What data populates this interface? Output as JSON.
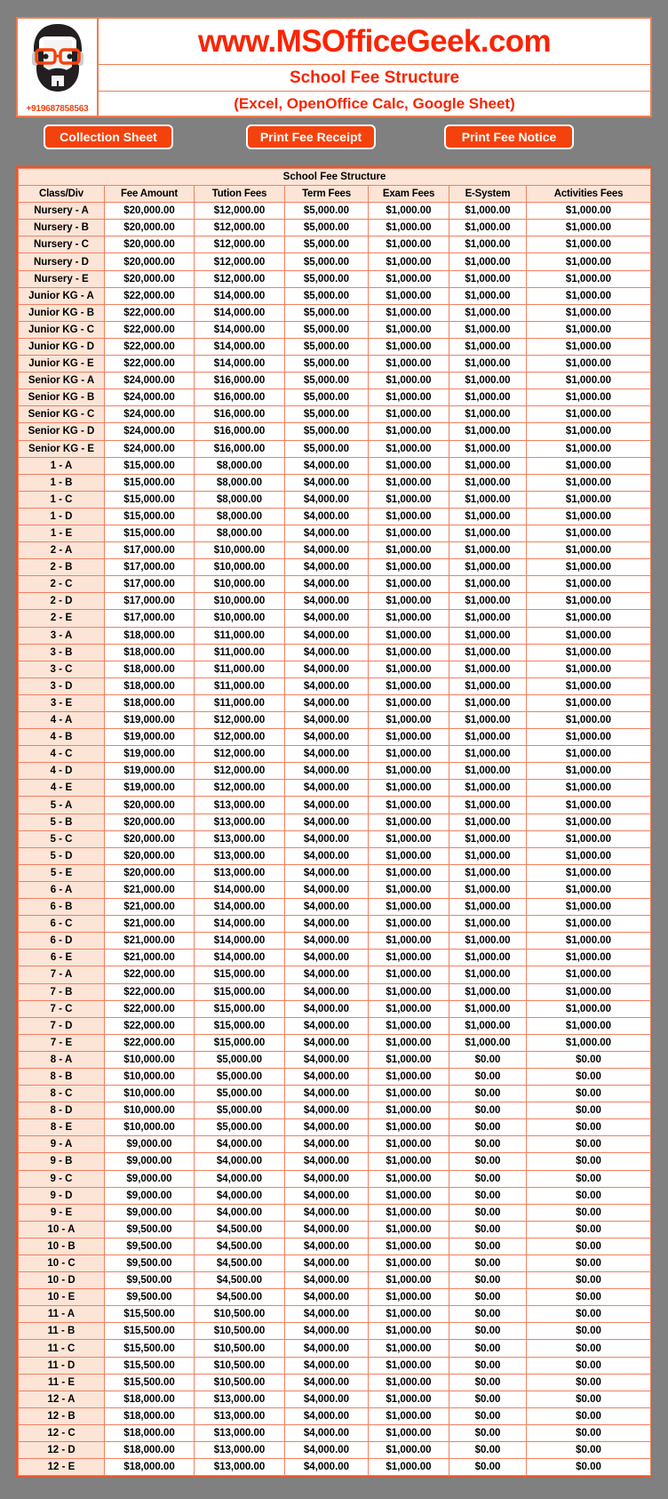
{
  "banner": {
    "site_title": "www.MSOfficeGeek.com",
    "sub_title": "School Fee Structure",
    "sub_title2": "(Excel, OpenOffice Calc, Google Sheet)",
    "logo_phone": "+919687858563",
    "accent_red": "#FA2400",
    "accent_orange": "#F4420D",
    "border_orange": "#ED7D52",
    "row_peach": "#FCE4D6",
    "page_bg": "#808080"
  },
  "toolbar": {
    "collection_label": "Collection Sheet",
    "receipt_label": "Print Fee Receipt",
    "notice_label": "Print Fee Notice"
  },
  "table": {
    "title": "School Fee Structure",
    "columns": [
      "Class/Div",
      "Fee Amount",
      "Tution Fees",
      "Term Fees",
      "Exam Fees",
      "E-System",
      "Activities Fees"
    ],
    "rows": [
      [
        "Nursery - A",
        "$20,000.00",
        "$12,000.00",
        "$5,000.00",
        "$1,000.00",
        "$1,000.00",
        "$1,000.00"
      ],
      [
        "Nursery - B",
        "$20,000.00",
        "$12,000.00",
        "$5,000.00",
        "$1,000.00",
        "$1,000.00",
        "$1,000.00"
      ],
      [
        "Nursery - C",
        "$20,000.00",
        "$12,000.00",
        "$5,000.00",
        "$1,000.00",
        "$1,000.00",
        "$1,000.00"
      ],
      [
        "Nursery - D",
        "$20,000.00",
        "$12,000.00",
        "$5,000.00",
        "$1,000.00",
        "$1,000.00",
        "$1,000.00"
      ],
      [
        "Nursery - E",
        "$20,000.00",
        "$12,000.00",
        "$5,000.00",
        "$1,000.00",
        "$1,000.00",
        "$1,000.00"
      ],
      [
        "Junior KG - A",
        "$22,000.00",
        "$14,000.00",
        "$5,000.00",
        "$1,000.00",
        "$1,000.00",
        "$1,000.00"
      ],
      [
        "Junior KG - B",
        "$22,000.00",
        "$14,000.00",
        "$5,000.00",
        "$1,000.00",
        "$1,000.00",
        "$1,000.00"
      ],
      [
        "Junior KG - C",
        "$22,000.00",
        "$14,000.00",
        "$5,000.00",
        "$1,000.00",
        "$1,000.00",
        "$1,000.00"
      ],
      [
        "Junior KG - D",
        "$22,000.00",
        "$14,000.00",
        "$5,000.00",
        "$1,000.00",
        "$1,000.00",
        "$1,000.00"
      ],
      [
        "Junior KG - E",
        "$22,000.00",
        "$14,000.00",
        "$5,000.00",
        "$1,000.00",
        "$1,000.00",
        "$1,000.00"
      ],
      [
        "Senior KG - A",
        "$24,000.00",
        "$16,000.00",
        "$5,000.00",
        "$1,000.00",
        "$1,000.00",
        "$1,000.00"
      ],
      [
        "Senior KG - B",
        "$24,000.00",
        "$16,000.00",
        "$5,000.00",
        "$1,000.00",
        "$1,000.00",
        "$1,000.00"
      ],
      [
        "Senior KG - C",
        "$24,000.00",
        "$16,000.00",
        "$5,000.00",
        "$1,000.00",
        "$1,000.00",
        "$1,000.00"
      ],
      [
        "Senior KG - D",
        "$24,000.00",
        "$16,000.00",
        "$5,000.00",
        "$1,000.00",
        "$1,000.00",
        "$1,000.00"
      ],
      [
        "Senior KG - E",
        "$24,000.00",
        "$16,000.00",
        "$5,000.00",
        "$1,000.00",
        "$1,000.00",
        "$1,000.00"
      ],
      [
        "1 - A",
        "$15,000.00",
        "$8,000.00",
        "$4,000.00",
        "$1,000.00",
        "$1,000.00",
        "$1,000.00"
      ],
      [
        "1 - B",
        "$15,000.00",
        "$8,000.00",
        "$4,000.00",
        "$1,000.00",
        "$1,000.00",
        "$1,000.00"
      ],
      [
        "1 - C",
        "$15,000.00",
        "$8,000.00",
        "$4,000.00",
        "$1,000.00",
        "$1,000.00",
        "$1,000.00"
      ],
      [
        "1 - D",
        "$15,000.00",
        "$8,000.00",
        "$4,000.00",
        "$1,000.00",
        "$1,000.00",
        "$1,000.00"
      ],
      [
        "1 - E",
        "$15,000.00",
        "$8,000.00",
        "$4,000.00",
        "$1,000.00",
        "$1,000.00",
        "$1,000.00"
      ],
      [
        "2 - A",
        "$17,000.00",
        "$10,000.00",
        "$4,000.00",
        "$1,000.00",
        "$1,000.00",
        "$1,000.00"
      ],
      [
        "2 - B",
        "$17,000.00",
        "$10,000.00",
        "$4,000.00",
        "$1,000.00",
        "$1,000.00",
        "$1,000.00"
      ],
      [
        "2 - C",
        "$17,000.00",
        "$10,000.00",
        "$4,000.00",
        "$1,000.00",
        "$1,000.00",
        "$1,000.00"
      ],
      [
        "2 - D",
        "$17,000.00",
        "$10,000.00",
        "$4,000.00",
        "$1,000.00",
        "$1,000.00",
        "$1,000.00"
      ],
      [
        "2 - E",
        "$17,000.00",
        "$10,000.00",
        "$4,000.00",
        "$1,000.00",
        "$1,000.00",
        "$1,000.00"
      ],
      [
        "3 - A",
        "$18,000.00",
        "$11,000.00",
        "$4,000.00",
        "$1,000.00",
        "$1,000.00",
        "$1,000.00"
      ],
      [
        "3 - B",
        "$18,000.00",
        "$11,000.00",
        "$4,000.00",
        "$1,000.00",
        "$1,000.00",
        "$1,000.00"
      ],
      [
        "3 - C",
        "$18,000.00",
        "$11,000.00",
        "$4,000.00",
        "$1,000.00",
        "$1,000.00",
        "$1,000.00"
      ],
      [
        "3 - D",
        "$18,000.00",
        "$11,000.00",
        "$4,000.00",
        "$1,000.00",
        "$1,000.00",
        "$1,000.00"
      ],
      [
        "3 - E",
        "$18,000.00",
        "$11,000.00",
        "$4,000.00",
        "$1,000.00",
        "$1,000.00",
        "$1,000.00"
      ],
      [
        "4 - A",
        "$19,000.00",
        "$12,000.00",
        "$4,000.00",
        "$1,000.00",
        "$1,000.00",
        "$1,000.00"
      ],
      [
        "4 - B",
        "$19,000.00",
        "$12,000.00",
        "$4,000.00",
        "$1,000.00",
        "$1,000.00",
        "$1,000.00"
      ],
      [
        "4 - C",
        "$19,000.00",
        "$12,000.00",
        "$4,000.00",
        "$1,000.00",
        "$1,000.00",
        "$1,000.00"
      ],
      [
        "4 - D",
        "$19,000.00",
        "$12,000.00",
        "$4,000.00",
        "$1,000.00",
        "$1,000.00",
        "$1,000.00"
      ],
      [
        "4 - E",
        "$19,000.00",
        "$12,000.00",
        "$4,000.00",
        "$1,000.00",
        "$1,000.00",
        "$1,000.00"
      ],
      [
        "5 - A",
        "$20,000.00",
        "$13,000.00",
        "$4,000.00",
        "$1,000.00",
        "$1,000.00",
        "$1,000.00"
      ],
      [
        "5 - B",
        "$20,000.00",
        "$13,000.00",
        "$4,000.00",
        "$1,000.00",
        "$1,000.00",
        "$1,000.00"
      ],
      [
        "5 - C",
        "$20,000.00",
        "$13,000.00",
        "$4,000.00",
        "$1,000.00",
        "$1,000.00",
        "$1,000.00"
      ],
      [
        "5 - D",
        "$20,000.00",
        "$13,000.00",
        "$4,000.00",
        "$1,000.00",
        "$1,000.00",
        "$1,000.00"
      ],
      [
        "5 - E",
        "$20,000.00",
        "$13,000.00",
        "$4,000.00",
        "$1,000.00",
        "$1,000.00",
        "$1,000.00"
      ],
      [
        "6 - A",
        "$21,000.00",
        "$14,000.00",
        "$4,000.00",
        "$1,000.00",
        "$1,000.00",
        "$1,000.00"
      ],
      [
        "6 - B",
        "$21,000.00",
        "$14,000.00",
        "$4,000.00",
        "$1,000.00",
        "$1,000.00",
        "$1,000.00"
      ],
      [
        "6 - C",
        "$21,000.00",
        "$14,000.00",
        "$4,000.00",
        "$1,000.00",
        "$1,000.00",
        "$1,000.00"
      ],
      [
        "6 - D",
        "$21,000.00",
        "$14,000.00",
        "$4,000.00",
        "$1,000.00",
        "$1,000.00",
        "$1,000.00"
      ],
      [
        "6 - E",
        "$21,000.00",
        "$14,000.00",
        "$4,000.00",
        "$1,000.00",
        "$1,000.00",
        "$1,000.00"
      ],
      [
        "7 - A",
        "$22,000.00",
        "$15,000.00",
        "$4,000.00",
        "$1,000.00",
        "$1,000.00",
        "$1,000.00"
      ],
      [
        "7 - B",
        "$22,000.00",
        "$15,000.00",
        "$4,000.00",
        "$1,000.00",
        "$1,000.00",
        "$1,000.00"
      ],
      [
        "7 - C",
        "$22,000.00",
        "$15,000.00",
        "$4,000.00",
        "$1,000.00",
        "$1,000.00",
        "$1,000.00"
      ],
      [
        "7 - D",
        "$22,000.00",
        "$15,000.00",
        "$4,000.00",
        "$1,000.00",
        "$1,000.00",
        "$1,000.00"
      ],
      [
        "7 - E",
        "$22,000.00",
        "$15,000.00",
        "$4,000.00",
        "$1,000.00",
        "$1,000.00",
        "$1,000.00"
      ],
      [
        "8 - A",
        "$10,000.00",
        "$5,000.00",
        "$4,000.00",
        "$1,000.00",
        "$0.00",
        "$0.00"
      ],
      [
        "8 - B",
        "$10,000.00",
        "$5,000.00",
        "$4,000.00",
        "$1,000.00",
        "$0.00",
        "$0.00"
      ],
      [
        "8 - C",
        "$10,000.00",
        "$5,000.00",
        "$4,000.00",
        "$1,000.00",
        "$0.00",
        "$0.00"
      ],
      [
        "8 - D",
        "$10,000.00",
        "$5,000.00",
        "$4,000.00",
        "$1,000.00",
        "$0.00",
        "$0.00"
      ],
      [
        "8 - E",
        "$10,000.00",
        "$5,000.00",
        "$4,000.00",
        "$1,000.00",
        "$0.00",
        "$0.00"
      ],
      [
        "9 - A",
        "$9,000.00",
        "$4,000.00",
        "$4,000.00",
        "$1,000.00",
        "$0.00",
        "$0.00"
      ],
      [
        "9 - B",
        "$9,000.00",
        "$4,000.00",
        "$4,000.00",
        "$1,000.00",
        "$0.00",
        "$0.00"
      ],
      [
        "9 - C",
        "$9,000.00",
        "$4,000.00",
        "$4,000.00",
        "$1,000.00",
        "$0.00",
        "$0.00"
      ],
      [
        "9 - D",
        "$9,000.00",
        "$4,000.00",
        "$4,000.00",
        "$1,000.00",
        "$0.00",
        "$0.00"
      ],
      [
        "9 - E",
        "$9,000.00",
        "$4,000.00",
        "$4,000.00",
        "$1,000.00",
        "$0.00",
        "$0.00"
      ],
      [
        "10 - A",
        "$9,500.00",
        "$4,500.00",
        "$4,000.00",
        "$1,000.00",
        "$0.00",
        "$0.00"
      ],
      [
        "10 - B",
        "$9,500.00",
        "$4,500.00",
        "$4,000.00",
        "$1,000.00",
        "$0.00",
        "$0.00"
      ],
      [
        "10 - C",
        "$9,500.00",
        "$4,500.00",
        "$4,000.00",
        "$1,000.00",
        "$0.00",
        "$0.00"
      ],
      [
        "10 - D",
        "$9,500.00",
        "$4,500.00",
        "$4,000.00",
        "$1,000.00",
        "$0.00",
        "$0.00"
      ],
      [
        "10 - E",
        "$9,500.00",
        "$4,500.00",
        "$4,000.00",
        "$1,000.00",
        "$0.00",
        "$0.00"
      ],
      [
        "11 - A",
        "$15,500.00",
        "$10,500.00",
        "$4,000.00",
        "$1,000.00",
        "$0.00",
        "$0.00"
      ],
      [
        "11 - B",
        "$15,500.00",
        "$10,500.00",
        "$4,000.00",
        "$1,000.00",
        "$0.00",
        "$0.00"
      ],
      [
        "11 - C",
        "$15,500.00",
        "$10,500.00",
        "$4,000.00",
        "$1,000.00",
        "$0.00",
        "$0.00"
      ],
      [
        "11 - D",
        "$15,500.00",
        "$10,500.00",
        "$4,000.00",
        "$1,000.00",
        "$0.00",
        "$0.00"
      ],
      [
        "11 - E",
        "$15,500.00",
        "$10,500.00",
        "$4,000.00",
        "$1,000.00",
        "$0.00",
        "$0.00"
      ],
      [
        "12 - A",
        "$18,000.00",
        "$13,000.00",
        "$4,000.00",
        "$1,000.00",
        "$0.00",
        "$0.00"
      ],
      [
        "12 - B",
        "$18,000.00",
        "$13,000.00",
        "$4,000.00",
        "$1,000.00",
        "$0.00",
        "$0.00"
      ],
      [
        "12 - C",
        "$18,000.00",
        "$13,000.00",
        "$4,000.00",
        "$1,000.00",
        "$0.00",
        "$0.00"
      ],
      [
        "12 - D",
        "$18,000.00",
        "$13,000.00",
        "$4,000.00",
        "$1,000.00",
        "$0.00",
        "$0.00"
      ],
      [
        "12 - E",
        "$18,000.00",
        "$13,000.00",
        "$4,000.00",
        "$1,000.00",
        "$0.00",
        "$0.00"
      ]
    ]
  }
}
